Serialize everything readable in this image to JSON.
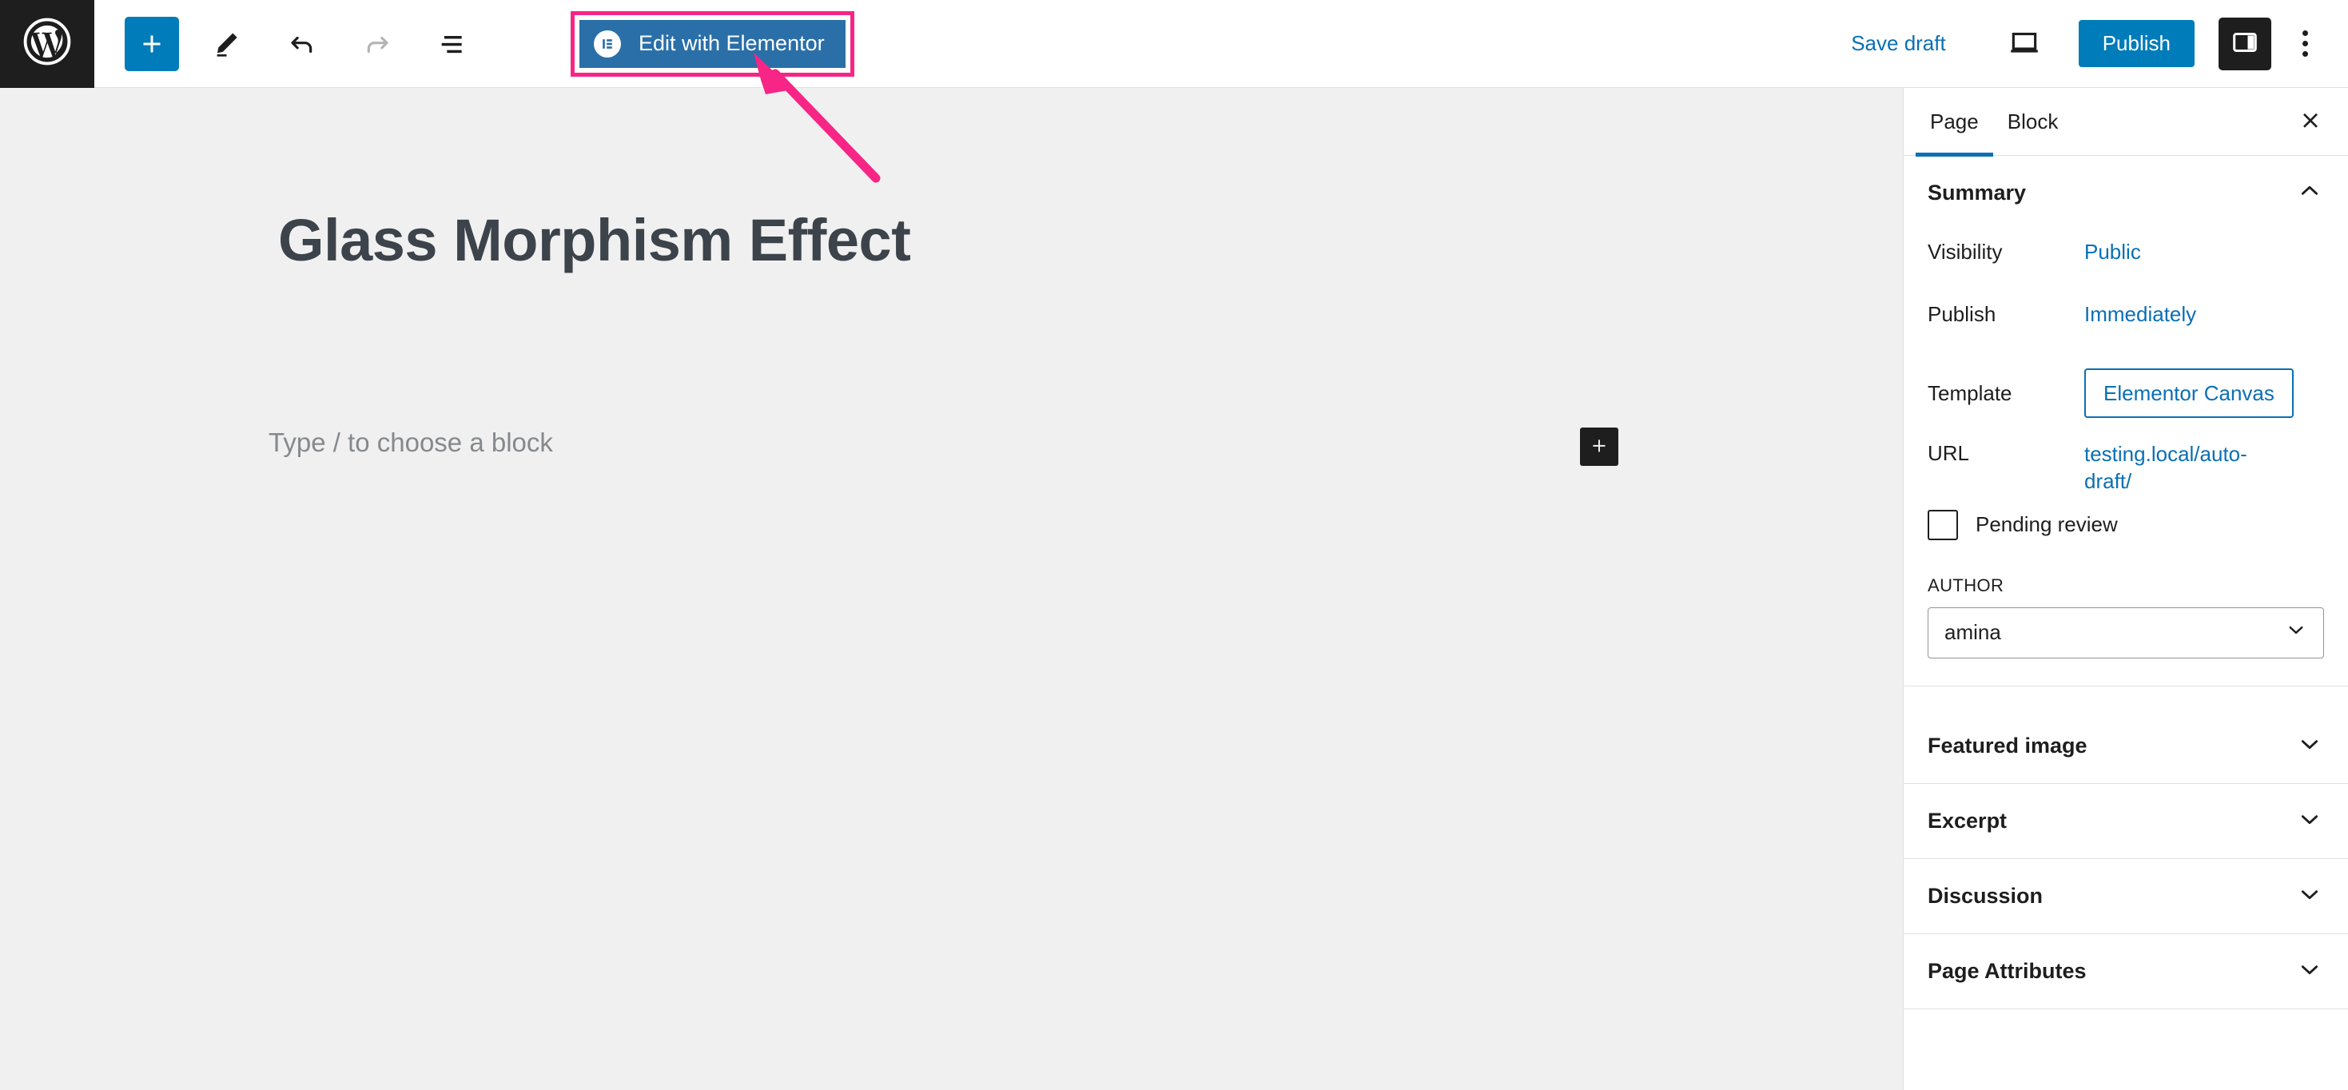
{
  "toolbar": {
    "logo_icon": "wordpress-logo-icon",
    "add_block_label": "+",
    "add_block_icon": "plus-icon",
    "tools_icon": "pencil-icon",
    "undo_icon": "undo-arrow-icon",
    "redo_icon": "redo-arrow-icon",
    "list_view_icon": "document-overview-icon",
    "elementor_label": "Edit with Elementor",
    "elementor_icon": "elementor-logo-icon",
    "save_draft_label": "Save draft",
    "preview_icon": "desktop-preview-icon",
    "publish_label": "Publish",
    "settings_icon": "sidebar-toggle-icon",
    "more_icon": "three-dots-vertical-icon"
  },
  "canvas": {
    "post_title": "Glass Morphism Effect",
    "block_placeholder": "Type / to choose a block",
    "inserter_icon": "plus-icon"
  },
  "annotation": {
    "arrow_color": "#f72585",
    "highlight_color": "#f72585",
    "target": "Edit with Elementor"
  },
  "sidebar": {
    "tabs": [
      {
        "label": "Page",
        "active": true
      },
      {
        "label": "Block",
        "active": false
      }
    ],
    "close_icon": "close-x-icon",
    "summary": {
      "title": "Summary",
      "chevron_icon": "chevron-up-icon",
      "rows": [
        {
          "label": "Visibility",
          "value": "Public",
          "boxed": false
        },
        {
          "label": "Publish",
          "value": "Immediately",
          "boxed": false
        },
        {
          "label": "Template",
          "value": "Elementor Canvas",
          "boxed": true
        },
        {
          "label": "URL",
          "value": "testing.local/auto-draft/",
          "boxed": false
        }
      ],
      "pending_review_label": "Pending review",
      "pending_review_checked": false,
      "author_label": "AUTHOR",
      "author_value": "amina",
      "author_chevron_icon": "chevron-down-icon"
    },
    "panels": [
      {
        "label": "Featured image",
        "chevron_icon": "chevron-down-icon"
      },
      {
        "label": "Excerpt",
        "chevron_icon": "chevron-down-icon"
      },
      {
        "label": "Discussion",
        "chevron_icon": "chevron-down-icon"
      },
      {
        "label": "Page Attributes",
        "chevron_icon": "chevron-down-icon"
      }
    ]
  },
  "colors": {
    "wp_blue": "#007cba",
    "link_blue": "#0a6fb5",
    "elementor_blue": "#2a6fa8",
    "accent_pink": "#f72585",
    "dark": "#1e1e1e",
    "canvas_bg": "#f0f0f0"
  }
}
